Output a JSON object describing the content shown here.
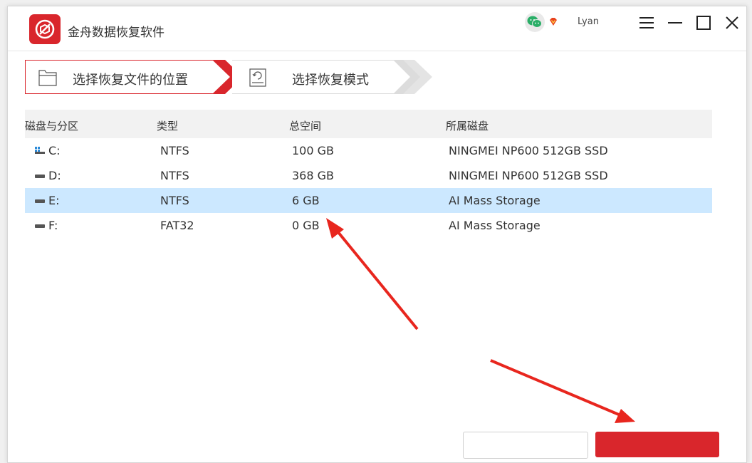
{
  "app": {
    "title": "金舟数据恢复软件"
  },
  "user": {
    "name": "Lyan"
  },
  "steps": [
    {
      "label": "选择恢复文件的位置",
      "active": true
    },
    {
      "label": "选择恢复模式",
      "active": false
    }
  ],
  "table": {
    "headers": [
      "磁盘与分区",
      "类型",
      "总空间",
      "所属磁盘"
    ],
    "rows": [
      {
        "partition": "C:",
        "type": "NTFS",
        "size": "100 GB",
        "disk": "NINGMEI NP600 512GB SSD",
        "icon": "system-drive-icon",
        "selected": false
      },
      {
        "partition": "D:",
        "type": "NTFS",
        "size": "368 GB",
        "disk": "NINGMEI NP600 512GB SSD",
        "icon": "drive-icon",
        "selected": false
      },
      {
        "partition": "E:",
        "type": "NTFS",
        "size": "6 GB",
        "disk": "AI Mass Storage",
        "icon": "drive-icon",
        "selected": true
      },
      {
        "partition": "F:",
        "type": "FAT32",
        "size": "0 GB",
        "disk": "AI Mass Storage",
        "icon": "drive-icon",
        "selected": false
      }
    ]
  },
  "colors": {
    "accent": "#d9262c",
    "selected_row": "#cce8ff",
    "header_bg": "#f2f2f2"
  }
}
